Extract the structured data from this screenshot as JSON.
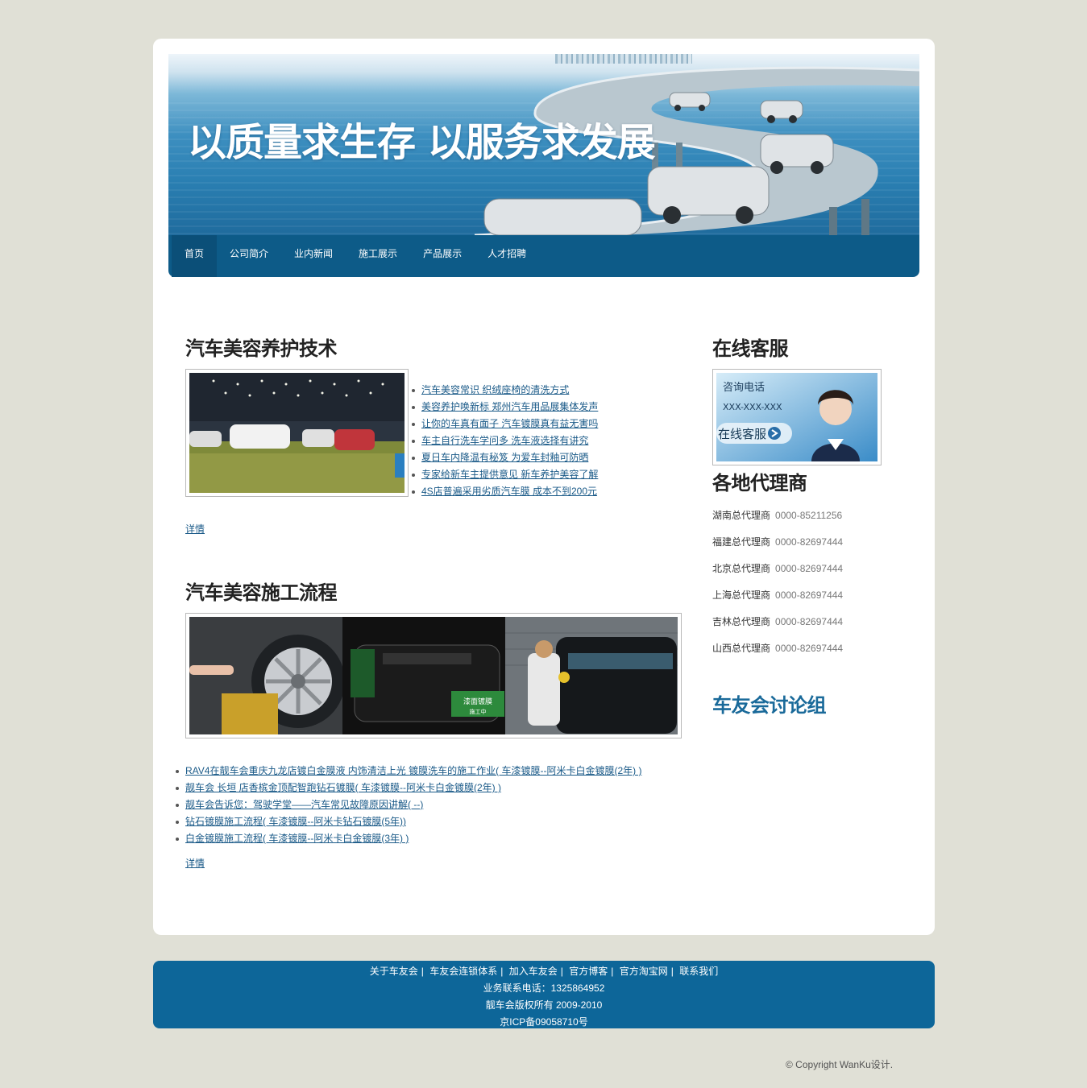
{
  "banner": {
    "slogan": "以质量求生存 以服务求发展"
  },
  "nav": {
    "items": [
      {
        "label": "首页"
      },
      {
        "label": "公司简介"
      },
      {
        "label": "业内新闻"
      },
      {
        "label": "施工展示"
      },
      {
        "label": "产品展示"
      },
      {
        "label": "人才招聘"
      }
    ]
  },
  "main": {
    "section1": {
      "title": "汽车美容养护技术",
      "news": [
        "汽车美容常识 织绒座椅的清洗方式",
        "美容养护唤新标 郑州汽车用品展集体发声",
        "让你的车真有面子 汽车镀膜真有益无害吗",
        "车主自行洗车学问多 洗车液选择有讲究",
        "夏日车内降温有秘笈 为爱车封釉可防晒",
        "专家给新车主提供意见 新车养护美容了解",
        "4S店普遍采用劣质汽车膜 成本不到200元"
      ],
      "detail": "详情"
    },
    "section2": {
      "title": "汽车美容施工流程",
      "news": [
        "RAV4在靓车会重庆九龙店镀白金膜液 内饰清洁上光 镀膜洗车的施工作业( 车漆镀膜--阿米卡白金镀膜(2年) )",
        "靓车会 长垣 店香槟金顶配智跑钻石镀膜( 车漆镀膜--阿米卡白金镀膜(2年) )",
        "靓车会告诉您：驾驶学堂——汽车常见故障原因讲解( --)",
        "钻石镀膜施工流程( 车漆镀膜--阿米卡钻石镀膜(5年))",
        "白金镀膜施工流程( 车漆镀膜--阿米卡白金镀膜(3年) )"
      ],
      "detail": "详情",
      "badge": "漆面镀膜",
      "badge_sub": "施工中"
    }
  },
  "sidebar": {
    "service_title": "在线客服",
    "service_image": {
      "line1": "咨询电话",
      "line2": "XXX-XXX-XXX",
      "line3": "在线客服"
    },
    "agents_title": "各地代理商",
    "agents": [
      {
        "name": "湖南总代理商",
        "phone": "0000-85211256"
      },
      {
        "name": "福建总代理商",
        "phone": "0000-82697444"
      },
      {
        "name": "北京总代理商",
        "phone": "0000-82697444"
      },
      {
        "name": "上海总代理商",
        "phone": "0000-82697444"
      },
      {
        "name": "吉林总代理商",
        "phone": "0000-82697444"
      },
      {
        "name": "山西总代理商",
        "phone": "0000-82697444"
      }
    ],
    "forum_title": "车友会讨论组"
  },
  "footer": {
    "links": [
      "关于车友会",
      "车友会连锁体系",
      "加入车友会",
      "官方博客",
      "官方淘宝网",
      "联系我们"
    ],
    "separator": "|",
    "contact": "业务联系电话：1325864952",
    "rights": "靓车会版权所有 2009-2010",
    "icp": "京ICP备09058710号"
  },
  "copyright": "© Copyright WanKu设计.",
  "colors": {
    "nav": "#0d5b88",
    "footer": "#0d6699",
    "link": "#1a5a88",
    "forum_title": "#1a6a9a"
  }
}
